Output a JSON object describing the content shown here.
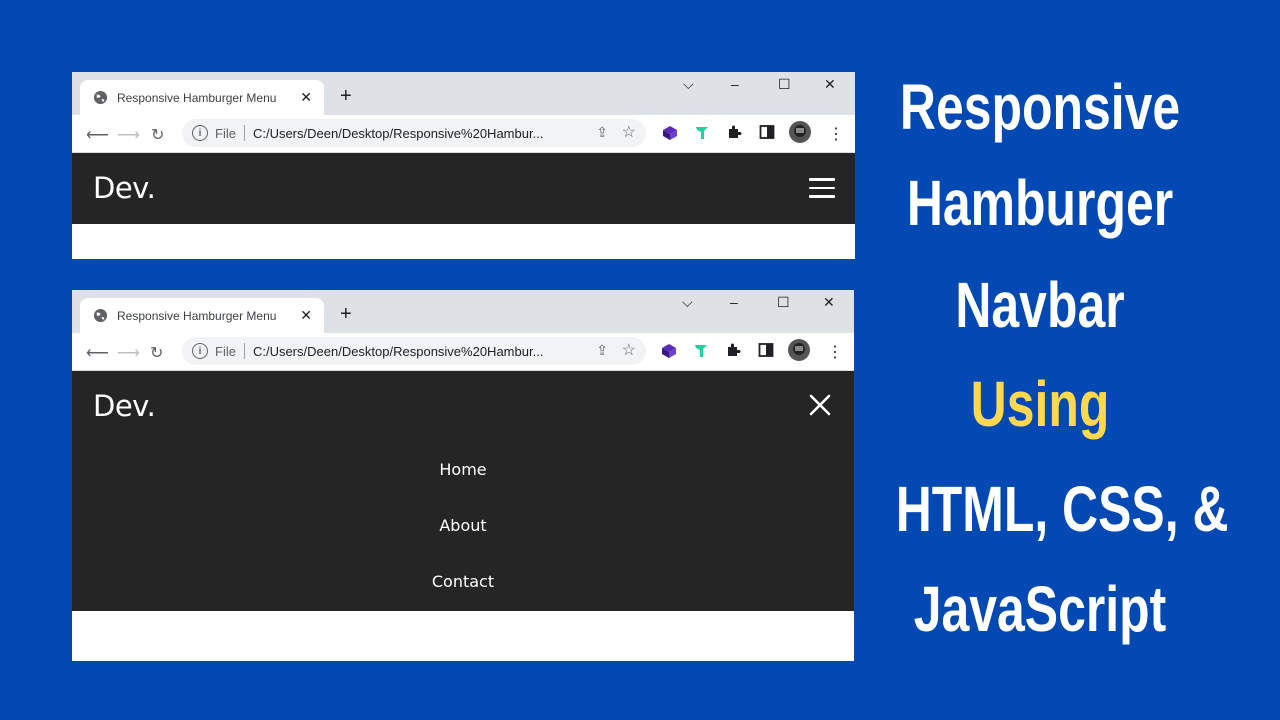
{
  "browser": {
    "tab_title": "Responsive Hamburger Menu",
    "tab_close": "✕",
    "new_tab": "+",
    "controls": {
      "dropdown": "⌵",
      "minimize": "–",
      "maximize": "☐",
      "close": "✕"
    },
    "address": {
      "scheme_label": "File",
      "url": "C:/Users/Deen/Desktop/Responsive%20Hambur..."
    },
    "icons": [
      "globe-icon",
      "back-icon",
      "forward-icon",
      "reload-icon",
      "info-icon",
      "share-icon",
      "star-icon",
      "extension-icon",
      "sidebar-icon",
      "avatar",
      "more-icon"
    ]
  },
  "site": {
    "logo": "Dev.",
    "menu": [
      "Home",
      "About",
      "Contact"
    ]
  },
  "headline": {
    "line1": "Responsive",
    "line2": "Hamburger",
    "line3": "Navbar",
    "line4": "Using",
    "line5": "HTML, CSS, &",
    "line6": "JavaScript"
  },
  "colors": {
    "background": "#0349b3",
    "navbar": "#252525",
    "accent": "#ffd84d"
  }
}
